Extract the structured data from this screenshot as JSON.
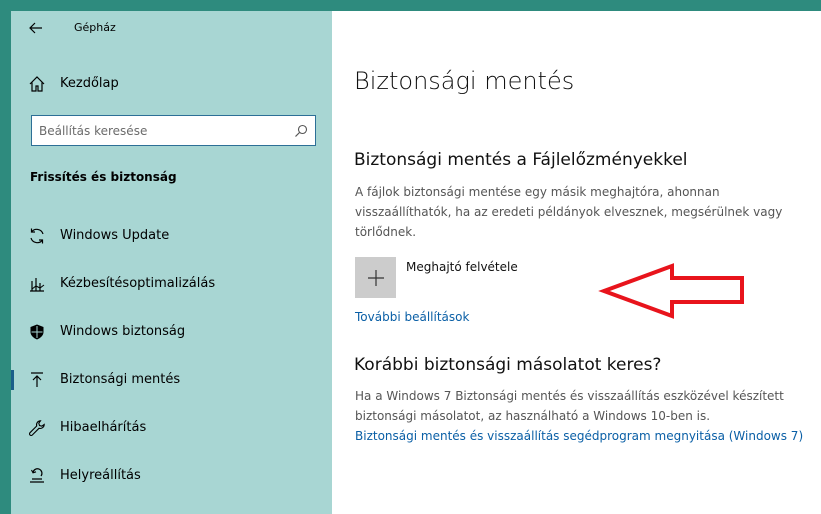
{
  "app": {
    "title": "Gépház"
  },
  "sidebar": {
    "home_label": "Kezdőlap",
    "search_placeholder": "Beállítás keresése",
    "section_title": "Frissítés és biztonság",
    "items": [
      {
        "label": "Windows Update",
        "icon": "sync-icon"
      },
      {
        "label": "Kézbesítésoptimalizálás",
        "icon": "delivery-optimization-icon"
      },
      {
        "label": "Windows biztonság",
        "icon": "shield-icon"
      },
      {
        "label": "Biztonsági mentés",
        "icon": "backup-arrow-icon",
        "active": true
      },
      {
        "label": "Hibaelhárítás",
        "icon": "wrench-icon"
      },
      {
        "label": "Helyreállítás",
        "icon": "recovery-icon"
      }
    ]
  },
  "main": {
    "title": "Biztonsági mentés",
    "file_history": {
      "heading": "Biztonsági mentés a Fájlelőzményekkel",
      "description": "A fájlok biztonsági mentése egy másik meghajtóra, ahonnan visszaállíthatók, ha az eredeti példányok elvesznek, megsérülnek vagy törlődnek.",
      "add_drive_label": "Meghajtó felvétele",
      "more_options_link": "További beállítások"
    },
    "older_backup": {
      "heading": "Korábbi biztonsági másolatot keres?",
      "description": "Ha a Windows 7 Biztonsági mentés és visszaállítás eszközével készített biztonsági másolatot, az használható a Windows 10-ben is.",
      "link": "Biztonsági mentés és visszaállítás segédprogram megnyitása (Windows 7)"
    }
  },
  "colors": {
    "desktop": "#2e8b7e",
    "sidebar": "#a8d6d3",
    "accent": "#0a5fa6",
    "annotation_arrow": "#e8141c"
  }
}
